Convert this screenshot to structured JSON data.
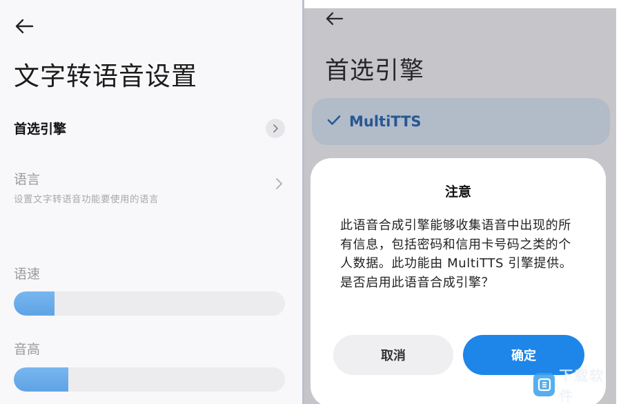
{
  "left": {
    "title": "文字转语音设置",
    "engine_row": {
      "label": "首选引擎"
    },
    "language_row": {
      "label": "语言",
      "subtitle": "设置文字转语音功能要使用的语言"
    },
    "speed": {
      "label": "语速",
      "value": 0.15
    },
    "pitch": {
      "label": "音高",
      "value": 0.2
    },
    "accent_color": "#6aaced"
  },
  "right": {
    "title": "首选引擎",
    "engine_option": {
      "name": "MultiTTS",
      "selected": true,
      "check_icon": "check-icon"
    },
    "dialog": {
      "title": "注意",
      "body": "此语音合成引擎能够收集语音中出现的所有信息，包括密码和信用卡号码之类的个人数据。此功能由 MultiTTS 引擎提供。是否启用此语音合成引擎？",
      "cancel_label": "取消",
      "confirm_label": "确定",
      "confirm_color": "#1d86e8"
    }
  },
  "watermark": {
    "text": "下载软件",
    "icon": "download-logo-icon"
  }
}
